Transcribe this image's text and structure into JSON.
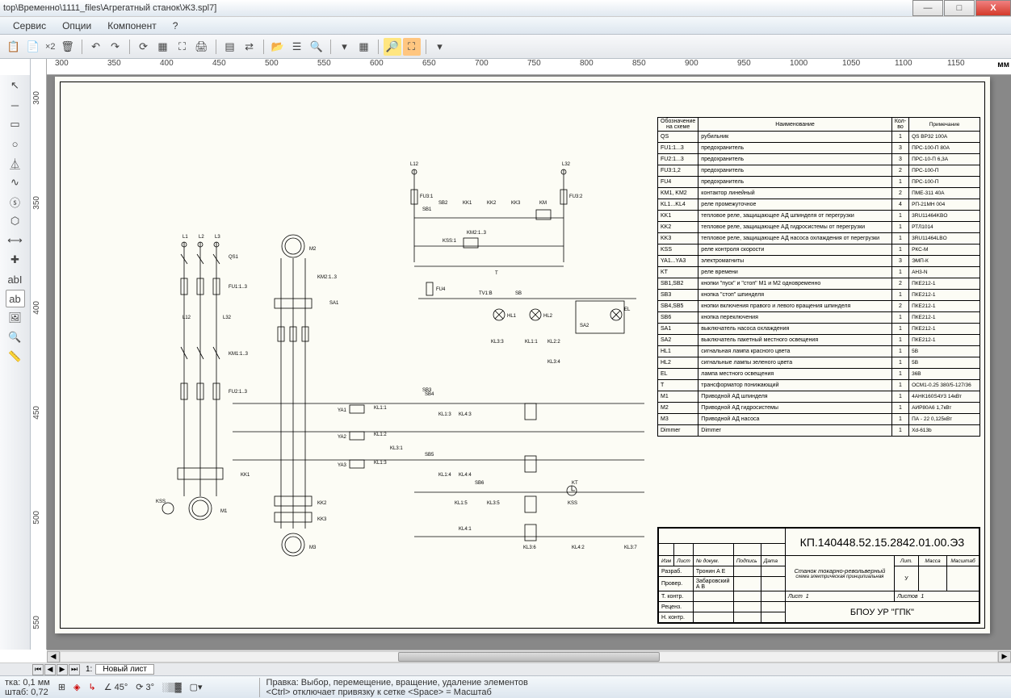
{
  "window": {
    "title": "top\\Временно\\1111_files\\Агрегатный станок\\Ж3.spl7]",
    "minimize": "—",
    "maximize": "□",
    "close": "X"
  },
  "menu": {
    "items": [
      "Сервис",
      "Опции",
      "Компонент",
      "?"
    ]
  },
  "ruler": {
    "unit": "мм",
    "hticks": [
      "300",
      "350",
      "400",
      "450",
      "500",
      "550",
      "600",
      "650",
      "700",
      "750",
      "800",
      "850",
      "900",
      "950",
      "1000",
      "1050",
      "1100",
      "1150"
    ],
    "vticks": [
      "300",
      "350",
      "400",
      "450",
      "500",
      "550"
    ]
  },
  "tabs": {
    "sheet_num": "1:",
    "sheet_name": "Новый лист"
  },
  "status": {
    "grid_label": "тка:",
    "grid_value": "0,1 мм",
    "scale_label": "штаб:",
    "scale_value": "0,72",
    "angle": "45°",
    "dangle": "3°",
    "hint1": "Правка: Выбор, перемещение, вращение, удаление элементов",
    "hint2": "<Ctrl> отключает привязку к сетке <Space> = Масштаб"
  },
  "parts_header": {
    "c1": "Обозначение на схеме",
    "c2": "Наименование",
    "c3": "Кол-во",
    "c4": "Примечание"
  },
  "parts": [
    {
      "ref": "QS",
      "name": "рубильник",
      "qty": "1",
      "note": "QS ВР32 100А"
    },
    {
      "ref": "FU1:1...3",
      "name": "предохранитель",
      "qty": "3",
      "note": "ПРС-100-П      80А"
    },
    {
      "ref": "FU2:1...3",
      "name": "предохранитель",
      "qty": "3",
      "note": "ПРС-10-П       6,3А"
    },
    {
      "ref": "FU3:1,2",
      "name": "предохранитель",
      "qty": "2",
      "note": "ПРС-100-П"
    },
    {
      "ref": "FU4",
      "name": "предохранитель",
      "qty": "1",
      "note": "ПРС-100-П"
    },
    {
      "ref": "KM1, KM2",
      "name": "контактор линейный",
      "qty": "2",
      "note": "ПМЕ-311   40А"
    },
    {
      "ref": "KL1...KL4",
      "name": "реле промежуточное",
      "qty": "4",
      "note": "РП-21МН 004"
    },
    {
      "ref": "KK1",
      "name": "тепловое реле, защищающее АД шпинделя от перегрузки",
      "qty": "1",
      "note": "3RU11464KBO"
    },
    {
      "ref": "KK2",
      "name": "тепловое реле, защищающее АД гидросистемы от перегрузки",
      "qty": "1",
      "note": "РТЛ1014"
    },
    {
      "ref": "KK3",
      "name": "тепловое реле, защищающее АД насоса охлаждения от перегрузки",
      "qty": "1",
      "note": "3RU11464LBO"
    },
    {
      "ref": "KSS",
      "name": "реле контроля скорости",
      "qty": "1",
      "note": "РКС-М"
    },
    {
      "ref": "YA1...YA3",
      "name": "электромагниты",
      "qty": "3",
      "note": "ЭМП-К"
    },
    {
      "ref": "KT",
      "name": "реле времени",
      "qty": "1",
      "note": "АН3-N"
    },
    {
      "ref": "SB1,SB2",
      "name": "кнопки \"пуск\" и \"стоп\" M1 и M2 одновременно",
      "qty": "2",
      "note": "ПКЕ212-1"
    },
    {
      "ref": "SB3",
      "name": "кнопка \"стоп\" шпинделя",
      "qty": "1",
      "note": "ПКЕ212-1"
    },
    {
      "ref": "SB4,SB5",
      "name": "кнопки включения правого и левого вращения шпинделя",
      "qty": "2",
      "note": "ПКЕ212-1"
    },
    {
      "ref": "SB6",
      "name": "кнопка переключения",
      "qty": "1",
      "note": "ПКЕ212-1"
    },
    {
      "ref": "SA1",
      "name": "выключатель насоса охлаждения",
      "qty": "1",
      "note": "ПКЕ212-1"
    },
    {
      "ref": "SA2",
      "name": "выключатель пакетный местного освещения",
      "qty": "1",
      "note": "ПКЕ212-1"
    },
    {
      "ref": "HL1",
      "name": "сигнальная лампа красного цвета",
      "qty": "1",
      "note": "5В"
    },
    {
      "ref": "HL2",
      "name": "сигнальные лампы зеленого цвета",
      "qty": "1",
      "note": "5В"
    },
    {
      "ref": "EL",
      "name": "лампа местного освещения",
      "qty": "1",
      "note": "36В"
    },
    {
      "ref": "T",
      "name": "трансформатор понижающий",
      "qty": "1",
      "note": "ОСМ1-0.25 380/5-127/36"
    },
    {
      "ref": "M1",
      "name": "Приводной АД шпинделя",
      "qty": "1",
      "note": "4АНК160S4У3  14кВт"
    },
    {
      "ref": "M2",
      "name": "Приводной АД гидросистемы",
      "qty": "1",
      "note": "АИР80А6      1,7кВт"
    },
    {
      "ref": "M3",
      "name": "Приводной АД насоса",
      "qty": "1",
      "note": "ПА - 22      0,125кВт"
    },
    {
      "ref": "Dimmer",
      "name": "Dimmer",
      "qty": "1",
      "note": "Xd-613b"
    }
  ],
  "titleblock": {
    "docnum": "КП.140448.52.15.2842.01.00.Э3",
    "desc1": "Станок токарно-револьверный",
    "desc2": "схема электрическая принципиальная",
    "org": "БПОУ УР \"ГПК\"",
    "rows": {
      "hdr_izm": "Изм",
      "hdr_list": "Лист",
      "hdr_ndok": "№ докум.",
      "hdr_podp": "Подпись",
      "hdr_data": "Дата",
      "razrab": "Разраб.",
      "razrab_name": "Тронин А Е",
      "prover": "Провер.",
      "prover_name": "Забаровский А В",
      "tkontr": "Т. контр.",
      "recenz": "Реценз.",
      "nkontr": "Н. контр.",
      "lit": "Лит.",
      "massa": "Масса",
      "masshtab": "Масштаб",
      "u": "У",
      "list": "Лист",
      "list_v": "1",
      "listov": "Листов",
      "listov_v": "1"
    }
  },
  "schematic_labels": {
    "l1": "L1",
    "l2": "L2",
    "l3": "L3",
    "l12": "L12",
    "l32": "L32",
    "qs1": "QS1",
    "fu11": "FU1:1..3",
    "fu21": "FU2:1..3",
    "fu31": "FU3:1",
    "fu32": "FU3:2",
    "fu4": "FU4",
    "km1": "KM1:1..3",
    "km2": "KM2:1..3",
    "km": "KM",
    "kk1": "KK1",
    "kk2": "KK2",
    "kk3": "KK3",
    "kss": "KSS",
    "m1": "M1",
    "m2": "M2",
    "m3": "M3",
    "t": "T",
    "el": "EL",
    "hl1": "HL1",
    "hl2": "HL2",
    "sa1": "SA1",
    "sa2": "SA2",
    "sb1": "SB1",
    "sb2": "SB2",
    "sb3": "SB3",
    "sb4": "SB4",
    "sb5": "SB5",
    "sb6": "SB6",
    "ya1": "YA1",
    "ya2": "YA2",
    "ya3": "YA3",
    "kt": "KT",
    "kl11": "KL1:1",
    "kl12": "KL1:2",
    "kl13": "KL1:3",
    "kl14": "KL1:4",
    "kl15": "KL1:5",
    "kl22": "KL2:2",
    "kl31": "KL3:1",
    "kl33": "KL3:3",
    "kl34": "KL3:4",
    "kl35": "KL3:5",
    "kl36": "KL3:6",
    "kl37": "KL3:7",
    "kl41": "KL4:1",
    "kl42": "KL4:2",
    "kl43": "KL4:3",
    "kl44": "KL4:4",
    "kss1": "KSS:1",
    "tv1b": "TV1:B",
    "sb": "SB"
  }
}
